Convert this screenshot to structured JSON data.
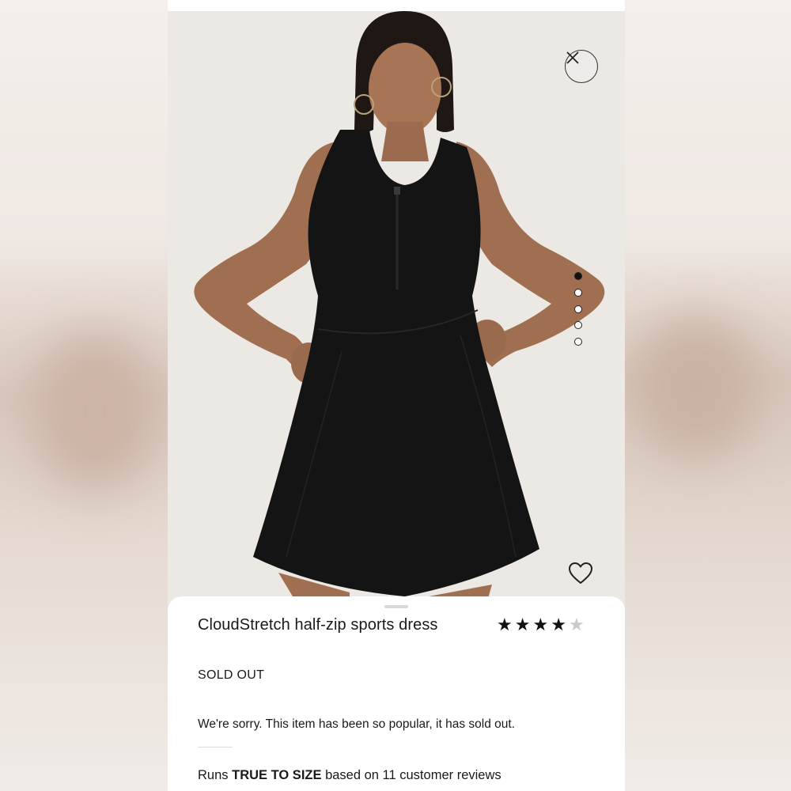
{
  "product": {
    "title": "CloudStretch half-zip sports dress",
    "rating": 4.5,
    "status": "SOLD OUT",
    "message": "We're sorry. This item has been so popular, it has sold out.",
    "fit": {
      "prefix": "Runs ",
      "emphasis": "TRUE TO SIZE",
      "suffix": " based on 11 customer reviews"
    }
  },
  "gallery": {
    "image_count": 5,
    "active_index": 0
  },
  "icons": {
    "close": "close-icon",
    "favorite": "heart-icon",
    "rating": "star-icon"
  },
  "colors": {
    "dress": "#141414",
    "background": "#ede9e6",
    "text": "#1a1a1a"
  }
}
